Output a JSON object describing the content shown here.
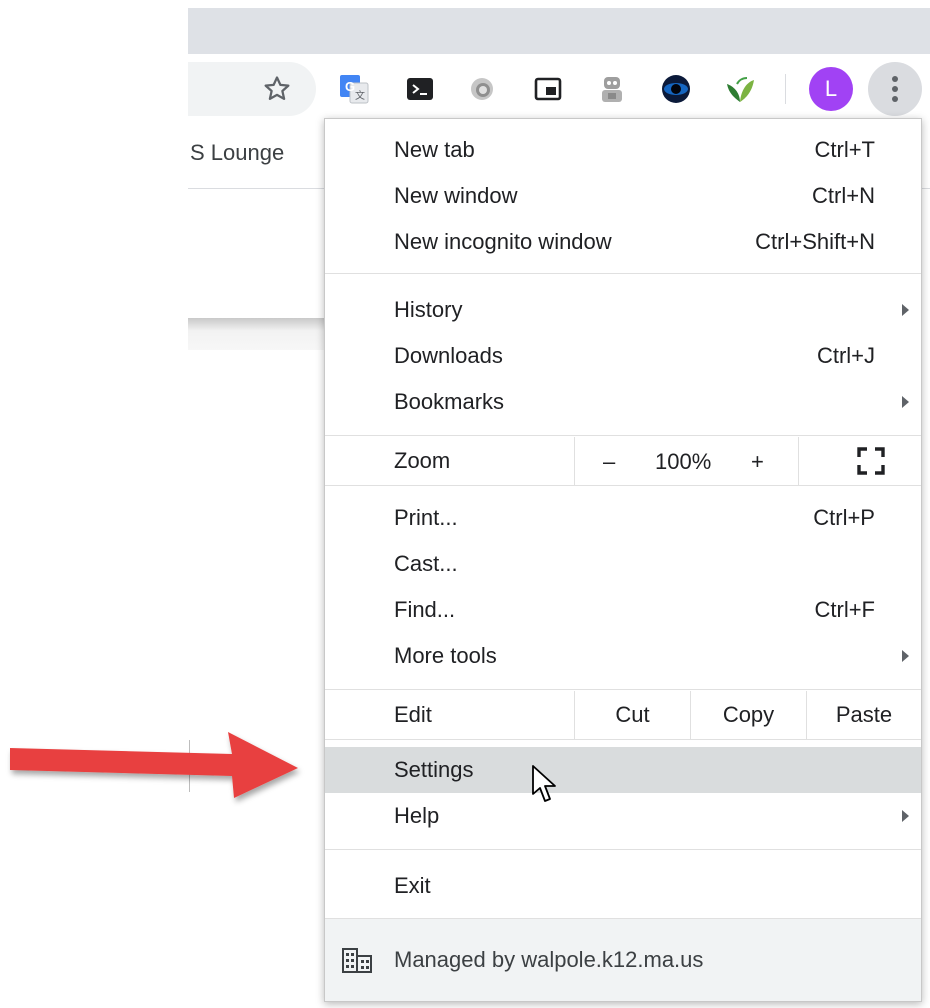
{
  "toolbar": {
    "bookmark_label": "S Lounge",
    "avatar_letter": "L",
    "icons": [
      "star-icon",
      "google-translate-icon",
      "terminal-icon",
      "clock-extension-icon",
      "picture-in-picture-icon",
      "robot-extension-icon",
      "eye-extension-icon",
      "leaf-extension-icon",
      "kebab-menu-icon"
    ]
  },
  "menu": {
    "new_tab": {
      "label": "New tab",
      "shortcut": "Ctrl+T"
    },
    "new_window": {
      "label": "New window",
      "shortcut": "Ctrl+N"
    },
    "new_incognito": {
      "label": "New incognito window",
      "shortcut": "Ctrl+Shift+N"
    },
    "history": {
      "label": "History"
    },
    "downloads": {
      "label": "Downloads",
      "shortcut": "Ctrl+J"
    },
    "bookmarks": {
      "label": "Bookmarks"
    },
    "zoom": {
      "label": "Zoom",
      "minus": "–",
      "value": "100%",
      "plus": "+"
    },
    "print": {
      "label": "Print...",
      "shortcut": "Ctrl+P"
    },
    "cast": {
      "label": "Cast..."
    },
    "find": {
      "label": "Find...",
      "shortcut": "Ctrl+F"
    },
    "more_tools": {
      "label": "More tools"
    },
    "edit": {
      "label": "Edit",
      "cut": "Cut",
      "copy": "Copy",
      "paste": "Paste"
    },
    "settings": {
      "label": "Settings"
    },
    "help": {
      "label": "Help"
    },
    "exit": {
      "label": "Exit"
    },
    "managed": {
      "label": "Managed by walpole.k12.ma.us"
    }
  },
  "colors": {
    "annotation_arrow": "#e8413f",
    "avatar": "#a142f4",
    "hover_row": "#d9dcdd"
  }
}
